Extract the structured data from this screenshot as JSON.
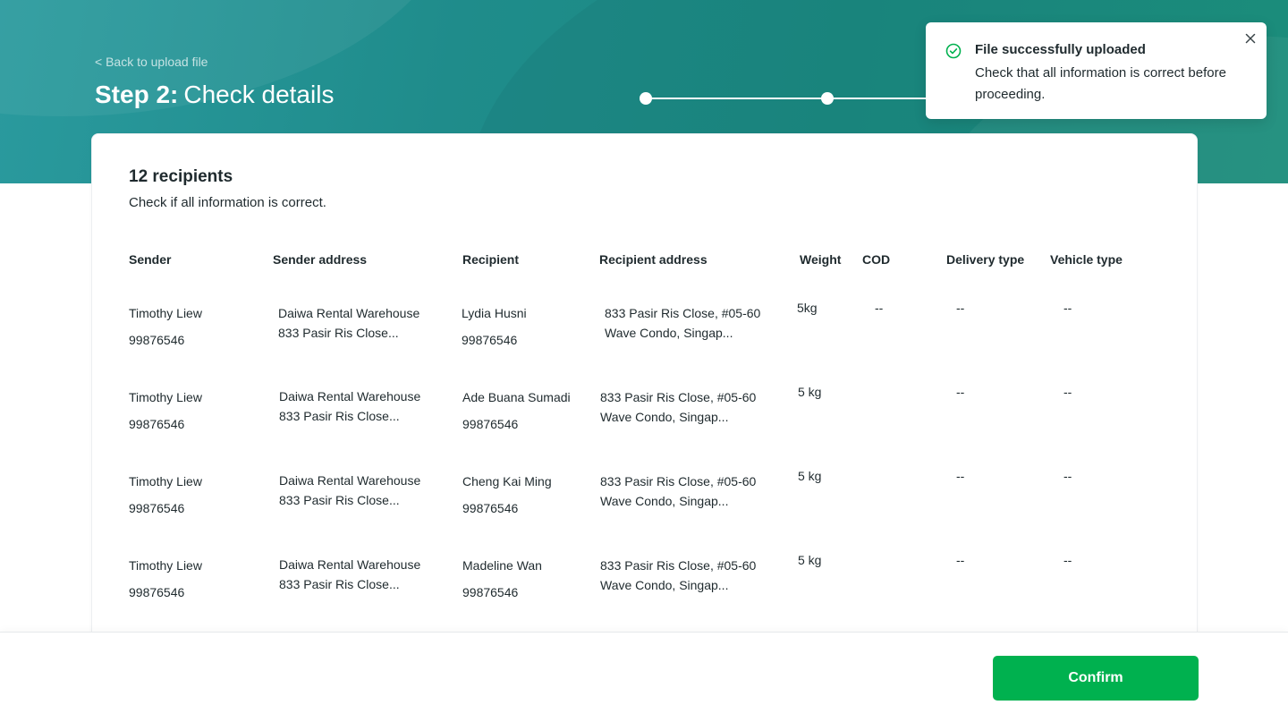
{
  "header": {
    "back_label": "< Back to upload file",
    "title_step": "Step 2:",
    "title_text": "Check details"
  },
  "toast": {
    "title": "File successfully uploaded",
    "message": "Check that all information is correct before proceeding.",
    "icon": "check-circle-icon",
    "close_icon": "close-icon"
  },
  "summary": {
    "count_label": "12 recipients",
    "subtitle": "Check if all information is correct."
  },
  "table": {
    "columns": [
      "Sender",
      "Sender address",
      "Recipient",
      "Recipient address",
      "Weight",
      "COD",
      "Delivery type",
      "Vehicle type"
    ],
    "rows": [
      {
        "sender": "Timothy Liew",
        "sender_phone": "99876546",
        "sender_addr_1": "Daiwa Rental Warehouse",
        "sender_addr_2": "833 Pasir Ris Close...",
        "recipient": "Lydia Husni",
        "recipient_phone": "99876546",
        "recipient_addr_1": "833 Pasir Ris Close, #05-60",
        "recipient_addr_2": "Wave Condo, Singap...",
        "weight": "5kg",
        "cod": "--",
        "delivery_type": "--",
        "vehicle_type": "--"
      },
      {
        "sender": "Timothy Liew",
        "sender_phone": "99876546",
        "sender_addr_1": "Daiwa Rental Warehouse",
        "sender_addr_2": "833 Pasir Ris Close...",
        "recipient": "Ade Buana Sumadi",
        "recipient_phone": "99876546",
        "recipient_addr_1": "833 Pasir Ris Close, #05-60",
        "recipient_addr_2": "Wave Condo, Singap...",
        "weight": "5 kg",
        "cod": "",
        "delivery_type": "--",
        "vehicle_type": "--"
      },
      {
        "sender": "Timothy Liew",
        "sender_phone": "99876546",
        "sender_addr_1": "Daiwa Rental Warehouse",
        "sender_addr_2": "833 Pasir Ris Close...",
        "recipient": "Cheng Kai Ming",
        "recipient_phone": "99876546",
        "recipient_addr_1": "833 Pasir Ris Close, #05-60",
        "recipient_addr_2": "Wave Condo, Singap...",
        "weight": "5 kg",
        "cod": "",
        "delivery_type": "--",
        "vehicle_type": "--"
      },
      {
        "sender": "Timothy Liew",
        "sender_phone": "99876546",
        "sender_addr_1": "Daiwa Rental Warehouse",
        "sender_addr_2": "833 Pasir Ris Close...",
        "recipient": "Madeline Wan",
        "recipient_phone": "99876546",
        "recipient_addr_1": "833 Pasir Ris Close, #05-60",
        "recipient_addr_2": "Wave Condo, Singap...",
        "weight": "5 kg",
        "cod": "",
        "delivery_type": "--",
        "vehicle_type": "--"
      }
    ]
  },
  "footer": {
    "confirm_label": "Confirm"
  },
  "colors": {
    "header_teal": "#1f8c8b",
    "primary_green": "#00b14f",
    "text_dark": "#1f2a2e"
  }
}
